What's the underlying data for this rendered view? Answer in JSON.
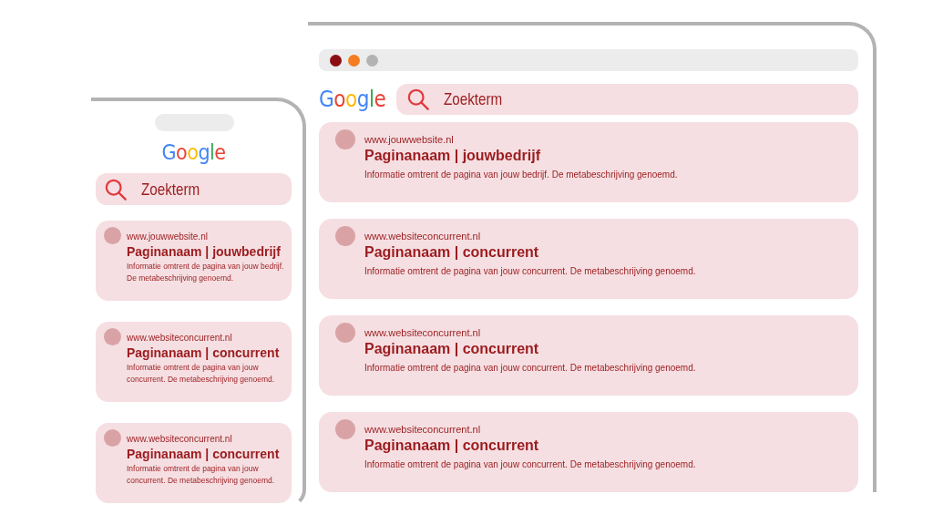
{
  "phone": {
    "logo": "Google",
    "search": {
      "value": "Zoekterm"
    },
    "results": [
      {
        "url": "www.jouwwebsite.nl",
        "title": "Paginanaam | jouwbedrijf",
        "description": "Informatie omtrent de pagina van jouw bedrijf. De metabeschrijving genoemd."
      },
      {
        "url": "www.websiteconcurrent.nl",
        "title": "Paginanaam | concurrent",
        "description": "Informatie omtrent de pagina van jouw concurrent. De metabeschrijving genoemd."
      },
      {
        "url": "www.websiteconcurrent.nl",
        "title": "Paginanaam | concurrent",
        "description": "Informatie omtrent de pagina van jouw concurrent. De metabeschrijving genoemd."
      }
    ]
  },
  "browser": {
    "window_controls": [
      {
        "color": "#8b0f12"
      },
      {
        "color": "#f57c1f"
      },
      {
        "color": "#b3b3b3"
      }
    ],
    "logo": "Google",
    "search": {
      "value": "Zoekterm"
    },
    "results": [
      {
        "url": "www.jouwwebsite.nl",
        "title": "Paginanaam | jouwbedrijf",
        "description": "Informatie omtrent de pagina van jouw bedrijf. De metabeschrijving genoemd."
      },
      {
        "url": "www.websiteconcurrent.nl",
        "title": "Paginanaam | concurrent",
        "description": "Informatie omtrent de pagina van jouw concurrent. De metabeschrijving genoemd."
      },
      {
        "url": "www.websiteconcurrent.nl",
        "title": "Paginanaam | concurrent",
        "description": "Informatie omtrent de pagina van jouw concurrent. De metabeschrijving genoemd."
      },
      {
        "url": "www.websiteconcurrent.nl",
        "title": "Paginanaam | concurrent",
        "description": "Informatie omtrent de pagina van jouw concurrent. De metabeschrijving genoemd."
      }
    ]
  }
}
